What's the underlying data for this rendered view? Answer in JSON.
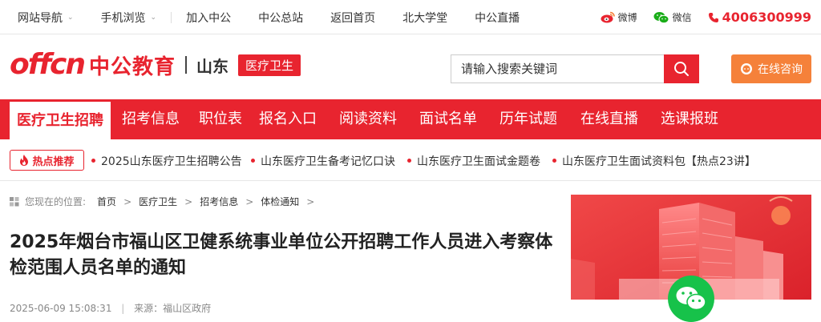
{
  "topbar": {
    "items": [
      {
        "label": "网站导航",
        "has_dropdown": true
      },
      {
        "label": "手机浏览",
        "has_dropdown": true
      },
      {
        "label": "加入中公"
      },
      {
        "label": "中公总站"
      },
      {
        "label": "返回首页"
      },
      {
        "label": "北大学堂"
      },
      {
        "label": "中公直播"
      }
    ],
    "weibo_label": "微博",
    "wechat_label": "微信",
    "phone": "4006300999"
  },
  "header": {
    "logo_latin": "offcn",
    "logo_cn": "中公教育",
    "region": "山东",
    "badge": "医疗卫生",
    "search_placeholder": "请输入搜索关键词",
    "consult_label": "在线咨询"
  },
  "mainnav": {
    "tabs": [
      {
        "label": "医疗卫生招聘",
        "active": true
      },
      {
        "label": "招考信息"
      },
      {
        "label": "职位表"
      },
      {
        "label": "报名入口"
      },
      {
        "label": "阅读资料"
      },
      {
        "label": "面试名单"
      },
      {
        "label": "历年试题"
      },
      {
        "label": "在线直播"
      },
      {
        "label": "选课报班"
      }
    ]
  },
  "hotbar": {
    "badge": "热点推荐",
    "links": [
      "2025山东医疗卫生招聘公告",
      "山东医疗卫生备考记忆口诀",
      "山东医疗卫生面试金题卷",
      "山东医疗卫生面试资料包【热点23讲】"
    ]
  },
  "breadcrumb": {
    "lead": "您现在的位置:",
    "items": [
      "首页",
      "医疗卫生",
      "招考信息",
      "体检通知"
    ]
  },
  "article": {
    "title": "2025年烟台市福山区卫健系统事业单位公开招聘工作人员进入考察体检范围人员名单的通知",
    "datetime": "2025-06-09 15:08:31",
    "source": "来源：福山区政府"
  },
  "colors": {
    "brand_red": "#e8242f",
    "consult_orange": "#f5813a",
    "wechat_green": "#17c24a"
  }
}
